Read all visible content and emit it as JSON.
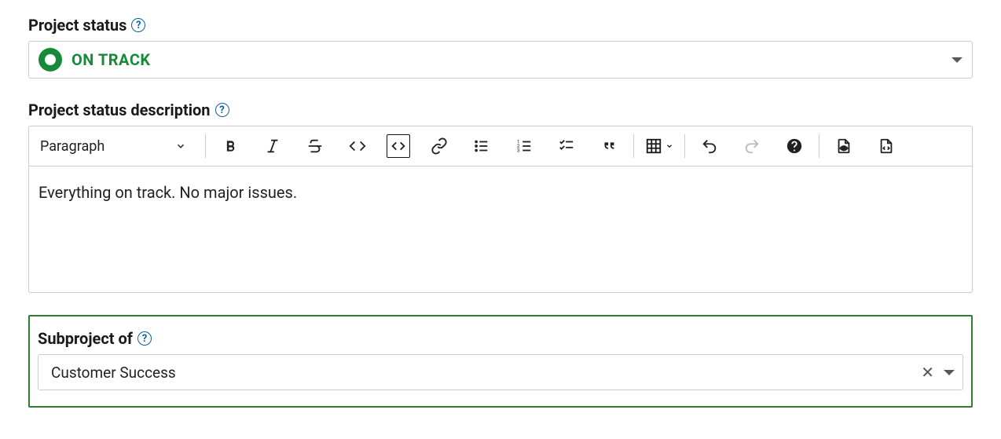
{
  "projectStatus": {
    "label": "Project status",
    "value": "ON TRACK",
    "color": "#178a3a"
  },
  "description": {
    "label": "Project status description",
    "blockType": "Paragraph",
    "content": "Everything on track. No major issues."
  },
  "subproject": {
    "label": "Subproject of",
    "value": "Customer Success"
  }
}
